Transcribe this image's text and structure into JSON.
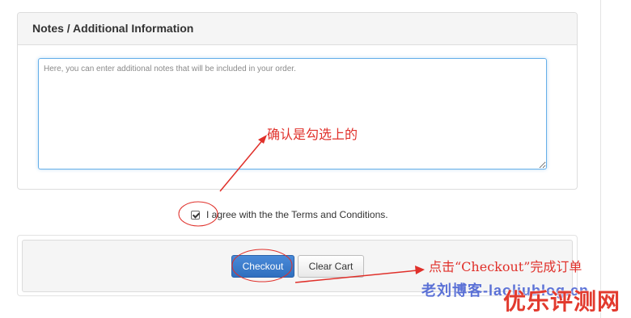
{
  "notes_panel": {
    "heading": "Notes / Additional Information",
    "notes_placeholder": "Here, you can enter additional notes that will be included in your order.",
    "notes_value": ""
  },
  "terms": {
    "checked": true,
    "label": "I agree with the the Terms and Conditions."
  },
  "actions": {
    "checkout_label": "Checkout",
    "clear_cart_label": "Clear Cart"
  },
  "annotations": {
    "confirm_checked": "确认是勾选上的",
    "click_checkout": "点击“Checkout”完成订单",
    "color": "#e0302a"
  },
  "watermarks": {
    "blog": "老刘博客-laoliublog.cn",
    "site": "优乐评测网"
  },
  "colors": {
    "primary_button": "#337ab7",
    "focus_border": "#66afe9",
    "panel_heading_bg": "#f5f5f5"
  }
}
